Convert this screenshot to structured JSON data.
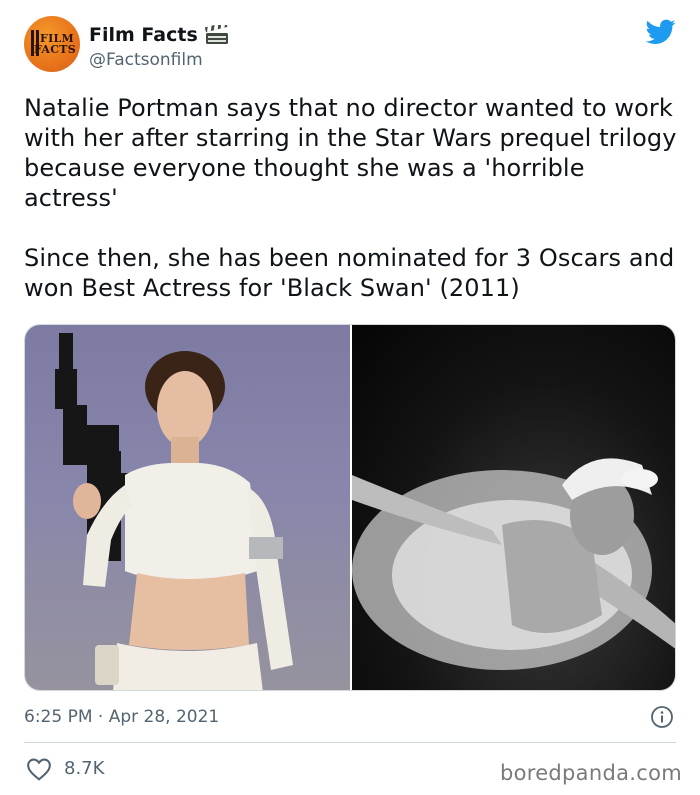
{
  "tweet": {
    "author": {
      "display_name": "Film Facts",
      "handle": "@Factsonfilm",
      "avatar_text_top": "FILM",
      "avatar_text_bottom": "FACTS",
      "badge_icon": "clapperboard-icon"
    },
    "text": "Natalie Portman says that no director wanted to work with her after starring in the Star Wars prequel trilogy because everyone thought she was a 'horrible actress'\n\nSince then, she has been nominated for 3 Oscars and won Best Actress for 'Black Swan' (2011)",
    "timestamp": "6:25 PM · Apr 28, 2021",
    "likes": "8.7K"
  },
  "watermark": "boredpanda.com",
  "colors": {
    "twitter_blue": "#1d9bf0",
    "text_primary": "#0f1419",
    "text_secondary": "#536471",
    "avatar_orange": "#e8731a"
  }
}
